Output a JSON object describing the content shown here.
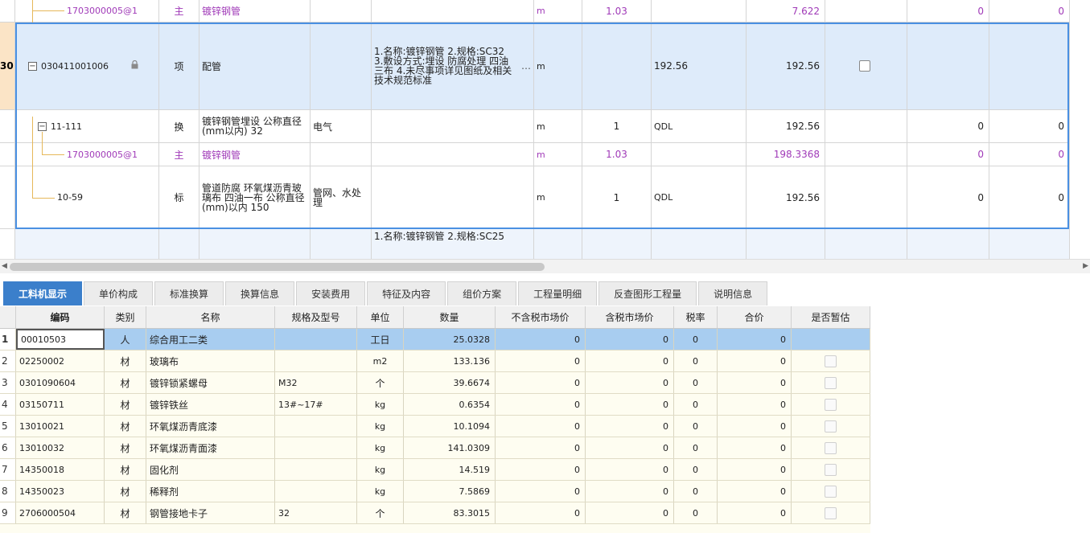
{
  "upper": {
    "rows": [
      {
        "num": "",
        "code": "1703000005@1",
        "type": "主",
        "name": "镀锌钢管",
        "spec": "",
        "feature": "",
        "unit": "m",
        "qty": "1.03",
        "expr": "",
        "amount": "7.622",
        "v1": "0",
        "v2": "0"
      },
      {
        "num": "30",
        "code": "030411001006",
        "type": "项",
        "name": "配管",
        "spec": "",
        "feature": "1.名称:镀锌钢管 2.规格:SC32 3.敷设方式:埋设 防腐处理 四油三布 4.未尽事项详见图纸及相关技术规范标准",
        "unit": "m",
        "qty": "",
        "expr": "192.56",
        "amount": "192.56",
        "v1": "",
        "v2": ""
      },
      {
        "num": "",
        "code": "11-111",
        "type": "换",
        "name": "镀锌钢管埋设 公称直径(mm以内) 32",
        "spec": "电气",
        "feature": "",
        "unit": "m",
        "qty": "1",
        "expr": "QDL",
        "amount": "192.56",
        "v1": "0",
        "v2": "0"
      },
      {
        "num": "",
        "code": "1703000005@1",
        "type": "主",
        "name": "镀锌钢管",
        "spec": "",
        "feature": "",
        "unit": "m",
        "qty": "1.03",
        "expr": "",
        "amount": "198.3368",
        "v1": "0",
        "v2": "0"
      },
      {
        "num": "",
        "code": "10-59",
        "type": "标",
        "name": "管道防腐 环氧煤沥青玻璃布 四油一布 公称直径(mm)以内 150",
        "spec": "管网、水处理",
        "feature": "",
        "unit": "m",
        "qty": "1",
        "expr": "QDL",
        "amount": "192.56",
        "v1": "0",
        "v2": "0"
      },
      {
        "num": "",
        "code": "",
        "type": "",
        "name": "",
        "spec": "",
        "feature": "1.名称:镀锌钢管 2.规格:SC25",
        "unit": "",
        "qty": "",
        "expr": "",
        "amount": "",
        "v1": "",
        "v2": ""
      }
    ]
  },
  "tabs": [
    "工料机显示",
    "单价构成",
    "标准换算",
    "换算信息",
    "安装费用",
    "特征及内容",
    "组价方案",
    "工程量明细",
    "反查图形工程量",
    "说明信息"
  ],
  "lower": {
    "headers": [
      "编码",
      "类别",
      "名称",
      "规格及型号",
      "单位",
      "数量",
      "不含税市场价",
      "含税市场价",
      "税率",
      "合价",
      "是否暂估"
    ],
    "rows": [
      {
        "num": "1",
        "code": "00010503",
        "cat": "人",
        "name": "综合用工二类",
        "spec": "",
        "unit": "工日",
        "qty": "25.0328",
        "p1": "0",
        "p2": "0",
        "tax": "0",
        "total": "0"
      },
      {
        "num": "2",
        "code": "02250002",
        "cat": "材",
        "name": "玻璃布",
        "spec": "",
        "unit": "m2",
        "qty": "133.136",
        "p1": "0",
        "p2": "0",
        "tax": "0",
        "total": "0"
      },
      {
        "num": "3",
        "code": "0301090604",
        "cat": "材",
        "name": "镀锌锁紧螺母",
        "spec": "M32",
        "unit": "个",
        "qty": "39.6674",
        "p1": "0",
        "p2": "0",
        "tax": "0",
        "total": "0"
      },
      {
        "num": "4",
        "code": "03150711",
        "cat": "材",
        "name": "镀锌铁丝",
        "spec": "13#~17#",
        "unit": "kg",
        "qty": "0.6354",
        "p1": "0",
        "p2": "0",
        "tax": "0",
        "total": "0"
      },
      {
        "num": "5",
        "code": "13010021",
        "cat": "材",
        "name": "环氧煤沥青底漆",
        "spec": "",
        "unit": "kg",
        "qty": "10.1094",
        "p1": "0",
        "p2": "0",
        "tax": "0",
        "total": "0"
      },
      {
        "num": "6",
        "code": "13010032",
        "cat": "材",
        "name": "环氧煤沥青面漆",
        "spec": "",
        "unit": "kg",
        "qty": "141.0309",
        "p1": "0",
        "p2": "0",
        "tax": "0",
        "total": "0"
      },
      {
        "num": "7",
        "code": "14350018",
        "cat": "材",
        "name": "固化剂",
        "spec": "",
        "unit": "kg",
        "qty": "14.519",
        "p1": "0",
        "p2": "0",
        "tax": "0",
        "total": "0"
      },
      {
        "num": "8",
        "code": "14350023",
        "cat": "材",
        "name": "稀释剂",
        "spec": "",
        "unit": "kg",
        "qty": "7.5869",
        "p1": "0",
        "p2": "0",
        "tax": "0",
        "total": "0"
      },
      {
        "num": "9",
        "code": "2706000504",
        "cat": "材",
        "name": "钢管接地卡子",
        "spec": "32",
        "unit": "个",
        "qty": "83.3015",
        "p1": "0",
        "p2": "0",
        "tax": "0",
        "total": "0"
      }
    ]
  },
  "colors": {
    "accent": "#3b7fcb",
    "selected_row": "#a8cdf0",
    "purple_text": "#a03ab8",
    "row_number_bg": "#fbe4c6"
  }
}
